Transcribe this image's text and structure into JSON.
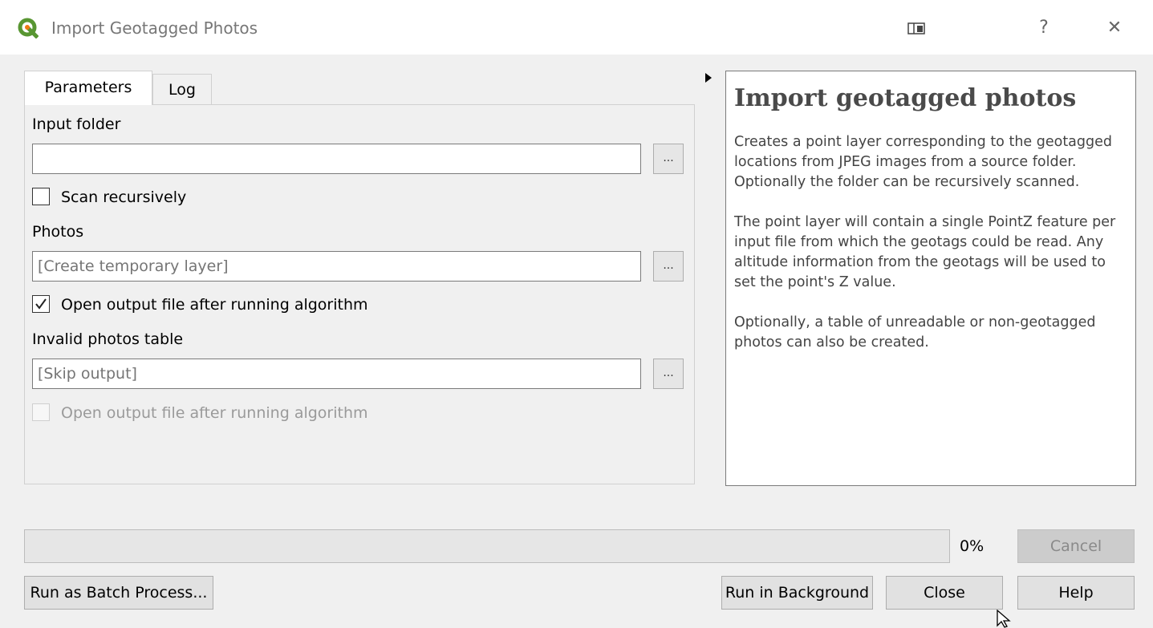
{
  "window": {
    "title": "Import Geotagged Photos",
    "controls": [
      "panel-toggle-icon",
      "help-icon",
      "close-icon"
    ],
    "help_glyph": "?",
    "close_glyph": "✕"
  },
  "tabs": [
    {
      "label": "Parameters",
      "active": true
    },
    {
      "label": "Log",
      "active": false
    }
  ],
  "params": {
    "input_folder": {
      "label": "Input folder",
      "value": "",
      "browse": "..."
    },
    "scan_recursively": {
      "label": "Scan recursively",
      "checked": false
    },
    "photos": {
      "label": "Photos",
      "placeholder": "[Create temporary layer]",
      "browse": "..."
    },
    "open_output_1": {
      "label": "Open output file after running algorithm",
      "checked": true
    },
    "invalid_table": {
      "label": "Invalid photos table",
      "placeholder": "[Skip output]",
      "browse": "..."
    },
    "open_output_2": {
      "label": "Open output file after running algorithm",
      "checked": false,
      "disabled": true
    }
  },
  "help": {
    "title": "Import geotagged photos",
    "paragraphs": [
      "Creates a point layer corresponding to the geotagged locations from JPEG images from a source folder. Optionally the folder can be recursively scanned.",
      "The point layer will contain a single PointZ feature per input file from which the geotags could be read. Any altitude information from the geotags will be used to set the point's Z value.",
      "Optionally, a table of unreadable or non-geotagged photos can also be created."
    ]
  },
  "progress": {
    "value": 0,
    "label": "0%"
  },
  "buttons": {
    "cancel": "Cancel",
    "batch": "Run as Batch Process...",
    "background": "Run in Background",
    "close": "Close",
    "help": "Help"
  },
  "colors": {
    "logo": "#589632",
    "progress": "#06b025"
  }
}
